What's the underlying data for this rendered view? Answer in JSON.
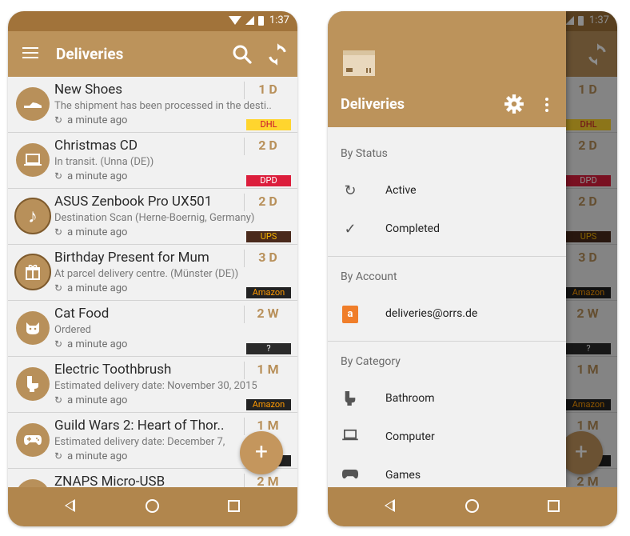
{
  "status_bar": {
    "time": "1:37"
  },
  "app": {
    "title": "Deliveries"
  },
  "deliveries": [
    {
      "title": "New Shoes",
      "subtitle": "The shipment has been processed in the desti..",
      "updated": "a minute ago",
      "age": "1 D",
      "carrier": "DHL",
      "badge_bg": "#ffd52e",
      "badge_fg": "#c8102e",
      "icon": "shoe-icon"
    },
    {
      "title": "Christmas CD",
      "subtitle": "In transit. (Unna (DE))",
      "updated": "a minute ago",
      "age": "2 D",
      "carrier": "DPD",
      "badge_bg": "#dc1e3c",
      "badge_fg": "#ffffff",
      "icon": "laptop-icon"
    },
    {
      "title": "ASUS Zenbook Pro UX501",
      "subtitle": "Destination Scan (Herne-Boernig, Germany)",
      "updated": "a minute ago",
      "age": "2 D",
      "carrier": "UPS",
      "badge_bg": "#4a2a1c",
      "badge_fg": "#f4b400",
      "icon": "music-note-icon"
    },
    {
      "title": "Birthday Present for Mum",
      "subtitle": "At parcel delivery centre. (Münster (DE))",
      "updated": "a minute ago",
      "age": "3 D",
      "carrier": "Amazon",
      "badge_bg": "#222222",
      "badge_fg": "#ff9900",
      "icon": "gift-icon"
    },
    {
      "title": "Cat Food",
      "subtitle": "Ordered",
      "updated": "a minute ago",
      "age": "2 W",
      "carrier": "?",
      "badge_bg": "#2b2b2b",
      "badge_fg": "#ffffff",
      "icon": "cat-icon"
    },
    {
      "title": "Electric Toothbrush",
      "subtitle": "Estimated delivery date: November 30, 2015",
      "updated": "a minute ago",
      "age": "1 M",
      "carrier": "Amazon",
      "badge_bg": "#222222",
      "badge_fg": "#ff9900",
      "icon": "toilet-icon"
    },
    {
      "title": "Guild Wars 2: Heart of Thor..",
      "subtitle": "Estimated delivery date: December 7,",
      "updated": "a minute ago",
      "age": "1 M",
      "carrier": "",
      "badge_bg": "#222222",
      "badge_fg": "#ff9900",
      "icon": "gamepad-icon"
    },
    {
      "title": "ZNAPS Micro-USB",
      "subtitle": "",
      "updated": "",
      "age": "2 M",
      "carrier": "",
      "badge_bg": "#222222",
      "badge_fg": "#ff9900",
      "icon": "cable-icon"
    }
  ],
  "fab": {
    "label": "+"
  },
  "drawer": {
    "title": "Deliveries",
    "sections": {
      "status": {
        "header": "By Status",
        "items": [
          {
            "label": "Active"
          },
          {
            "label": "Completed"
          }
        ]
      },
      "account": {
        "header": "By Account",
        "items": [
          {
            "label": "deliveries@orrs.de",
            "icon_letter": "a"
          }
        ]
      },
      "category": {
        "header": "By Category",
        "items": [
          {
            "label": "Bathroom"
          },
          {
            "label": "Computer"
          },
          {
            "label": "Games"
          }
        ]
      }
    }
  },
  "colors": {
    "primary": "#bc935b",
    "primary_dark": "#a1733a",
    "accent": "#c4965d",
    "nav": "#b1864d"
  }
}
